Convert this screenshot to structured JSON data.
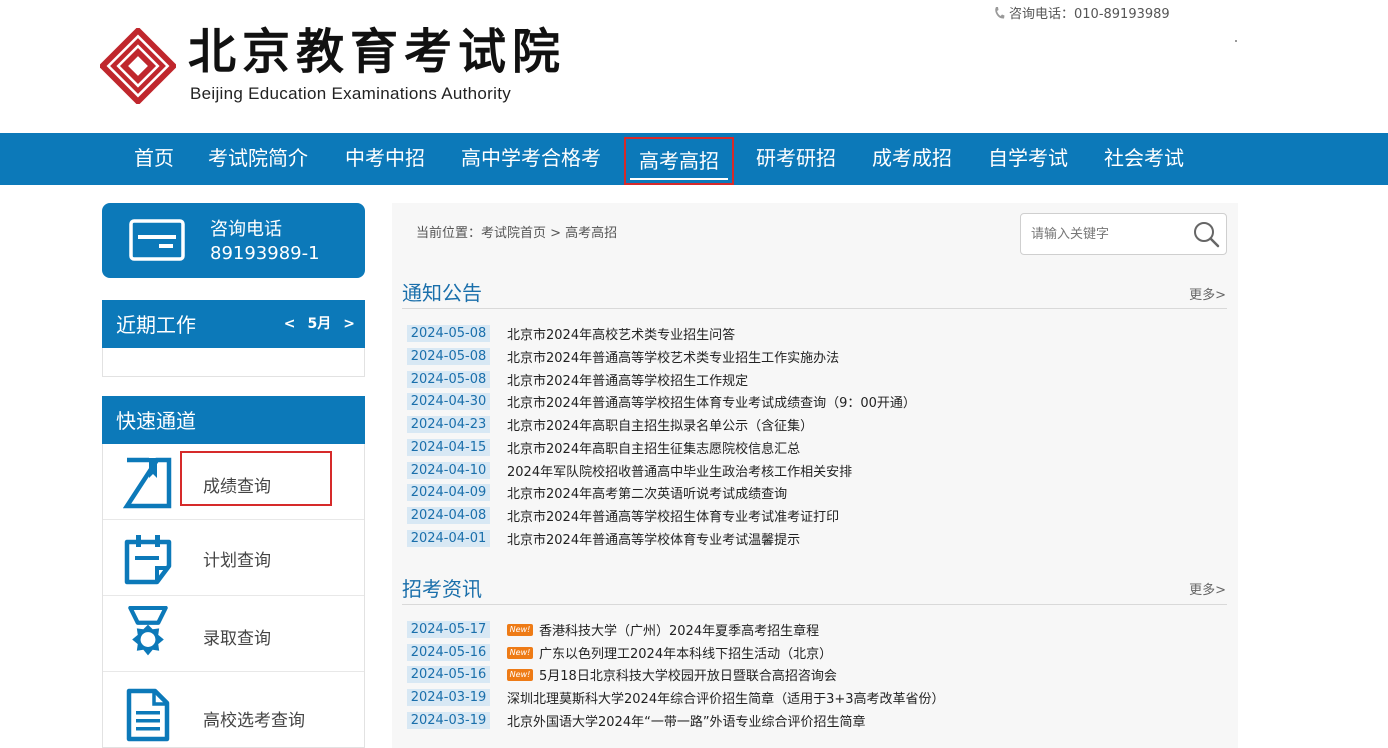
{
  "header": {
    "title_cn": "北京教育考试院",
    "title_en": "Beijing Education Examinations Authority",
    "hotline": "咨询电话：010-89193989",
    "brand_color": "#c0272d"
  },
  "nav": {
    "items": [
      {
        "label": "首页"
      },
      {
        "label": "考试院简介"
      },
      {
        "label": "中考中招"
      },
      {
        "label": "高中学考合格考"
      },
      {
        "label": "高考高招",
        "active": true
      },
      {
        "label": "研考研招"
      },
      {
        "label": "成考成招"
      },
      {
        "label": "自学考试"
      },
      {
        "label": "社会考试"
      }
    ],
    "bg_color": "#0c79b9"
  },
  "sidebar": {
    "hotline_card": {
      "label": "咨询电话",
      "number": "89193989-1",
      "icon": "card-icon"
    },
    "recent_work": {
      "title": "近期工作",
      "prev": "<",
      "month": "5月",
      "next": ">"
    },
    "quick": {
      "title": "快速通道",
      "items": [
        {
          "label": "成绩查询",
          "icon": "bookmark-icon"
        },
        {
          "label": "计划查询",
          "icon": "calendar-icon"
        },
        {
          "label": "录取查询",
          "icon": "medal-icon"
        },
        {
          "label": "高校选考查询",
          "icon": "document-icon"
        }
      ]
    }
  },
  "main": {
    "breadcrumb": "当前位置：考试院首页 > 高考高招",
    "search": {
      "placeholder": "请输入关键字",
      "value": ""
    },
    "notices": {
      "title": "通知公告",
      "more": "更多>",
      "items": [
        {
          "date": "2024-05-08",
          "title": "北京市2024年高校艺术类专业招生问答"
        },
        {
          "date": "2024-05-08",
          "title": "北京市2024年普通高等学校艺术类专业招生工作实施办法"
        },
        {
          "date": "2024-05-08",
          "title": "北京市2024年普通高等学校招生工作规定"
        },
        {
          "date": "2024-04-30",
          "title": "北京市2024年普通高等学校招生体育专业考试成绩查询（9：00开通）"
        },
        {
          "date": "2024-04-23",
          "title": "北京市2024年高职自主招生拟录名单公示（含征集）"
        },
        {
          "date": "2024-04-15",
          "title": "北京市2024年高职自主招生征集志愿院校信息汇总"
        },
        {
          "date": "2024-04-10",
          "title": "2024年军队院校招收普通高中毕业生政治考核工作相关安排"
        },
        {
          "date": "2024-04-09",
          "title": "北京市2024年高考第二次英语听说考试成绩查询"
        },
        {
          "date": "2024-04-08",
          "title": "北京市2024年普通高等学校招生体育专业考试准考证打印"
        },
        {
          "date": "2024-04-01",
          "title": "北京市2024年普通高等学校体育专业考试温馨提示"
        }
      ]
    },
    "recruit_news": {
      "title": "招考资讯",
      "more": "更多>",
      "new_badge": "New!",
      "items": [
        {
          "date": "2024-05-17",
          "title": "香港科技大学（广州）2024年夏季高考招生章程",
          "is_new": true
        },
        {
          "date": "2024-05-16",
          "title": "广东以色列理工2024年本科线下招生活动（北京）",
          "is_new": true
        },
        {
          "date": "2024-05-16",
          "title": "5月18日北京科技大学校园开放日暨联合高招咨询会",
          "is_new": true
        },
        {
          "date": "2024-03-19",
          "title": "深圳北理莫斯科大学2024年综合评价招生简章（适用于3+3高考改革省份）",
          "is_new": false
        },
        {
          "date": "2024-03-19",
          "title": "北京外国语大学2024年“一带一路”外语专业综合评价招生简章",
          "is_new": false
        }
      ]
    }
  }
}
